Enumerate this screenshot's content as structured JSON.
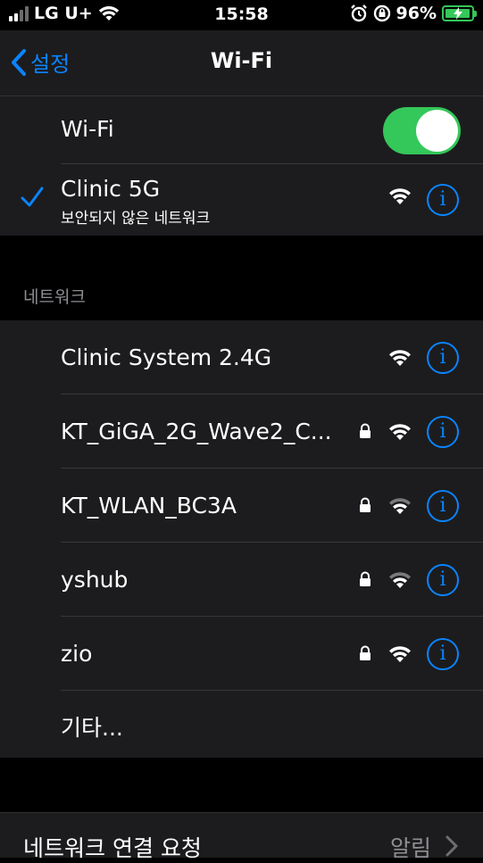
{
  "status": {
    "carrier": "LG U+",
    "time": "15:58",
    "battery": "96%",
    "battery_level": 0.96
  },
  "nav": {
    "back_label": "설정",
    "title": "Wi-Fi"
  },
  "wifi_toggle": {
    "label": "Wi-Fi",
    "on": true
  },
  "connected": {
    "name": "Clinic 5G",
    "subtitle": "보안되지 않은 네트워크"
  },
  "section_header": "네트워크",
  "networks": [
    {
      "name": "Clinic System 2.4G",
      "locked": false
    },
    {
      "name": "KT_GiGA_2G_Wave2_C...",
      "locked": true
    },
    {
      "name": "KT_WLAN_BC3A",
      "locked": true
    },
    {
      "name": "yshub",
      "locked": true
    },
    {
      "name": "zio",
      "locked": true
    }
  ],
  "other_label": "기타...",
  "ask_join": {
    "label": "네트워크 연결 요청",
    "value": "알림"
  },
  "info_glyph": "i",
  "accent": "#0a84ff",
  "toggle_color": "#34c759"
}
